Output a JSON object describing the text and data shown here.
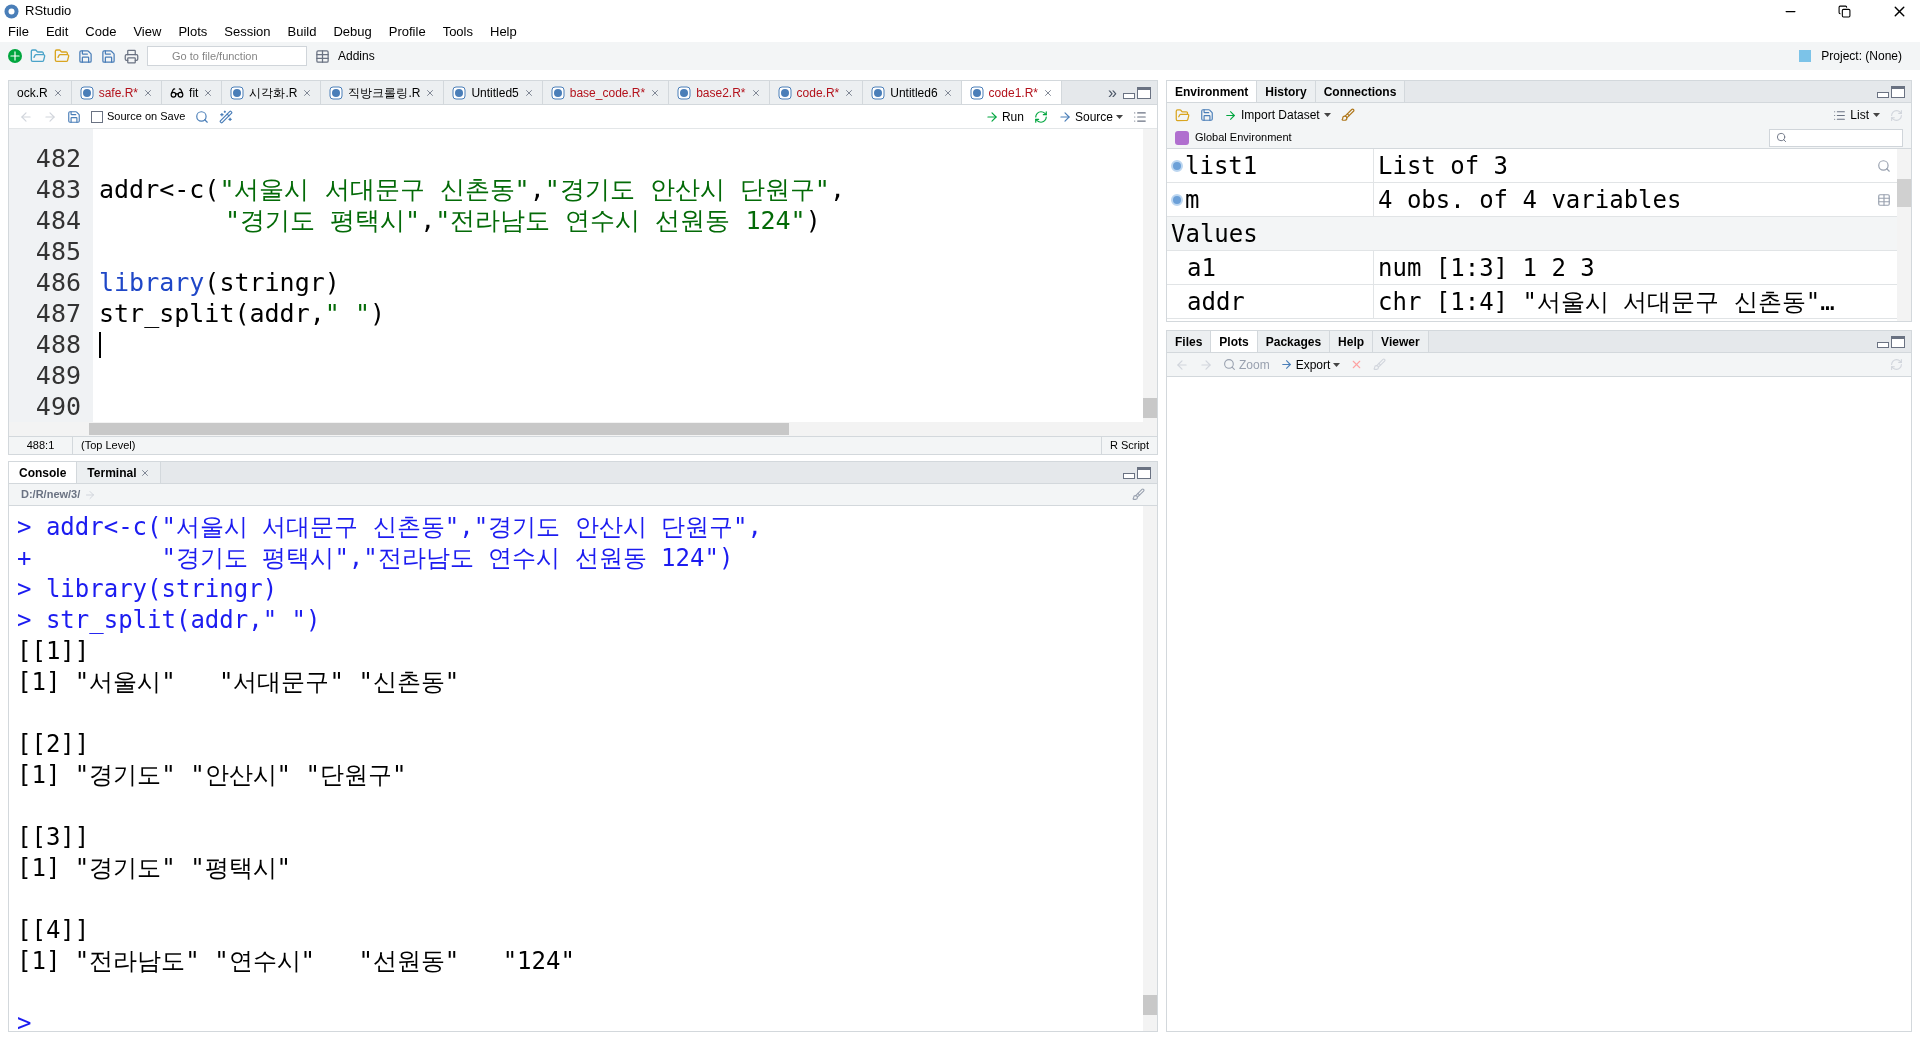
{
  "window": {
    "title": "RStudio"
  },
  "menu": [
    "File",
    "Edit",
    "Code",
    "View",
    "Plots",
    "Session",
    "Build",
    "Debug",
    "Profile",
    "Tools",
    "Help"
  ],
  "toolbar": {
    "search_placeholder": "Go to file/function",
    "addins": "Addins",
    "project": "Project: (None)"
  },
  "editor": {
    "tabs": [
      {
        "label": "ock.R",
        "kind": "clipped",
        "modified": false,
        "selected": false
      },
      {
        "label": "safe.R*",
        "kind": "script",
        "modified": true,
        "selected": false
      },
      {
        "label": "fit",
        "kind": "viewer",
        "modified": false,
        "selected": false
      },
      {
        "label": "시각화.R",
        "kind": "script",
        "modified": false,
        "selected": false
      },
      {
        "label": "직방크롤링.R",
        "kind": "script",
        "modified": false,
        "selected": false
      },
      {
        "label": "Untitled5",
        "kind": "script",
        "modified": false,
        "selected": false
      },
      {
        "label": "base_code.R*",
        "kind": "script",
        "modified": true,
        "selected": false
      },
      {
        "label": "base2.R*",
        "kind": "script",
        "modified": true,
        "selected": false
      },
      {
        "label": "code.R*",
        "kind": "script",
        "modified": true,
        "selected": false
      },
      {
        "label": "Untitled6",
        "kind": "script",
        "modified": false,
        "selected": false
      },
      {
        "label": "code1.R*",
        "kind": "script",
        "modified": true,
        "selected": true
      }
    ],
    "more_tabs": "»",
    "source_on_save": {
      "label": "Source on Save",
      "checked": false
    },
    "run": "Run",
    "source": "Source",
    "lines": [
      {
        "number": "482"
      },
      {
        "number": "483",
        "tokens": [
          {
            "kind": "plain",
            "text": "addr<-c("
          },
          {
            "kind": "string",
            "text": "\"서울시 서대문구 신촌동\""
          },
          {
            "kind": "plain",
            "text": ","
          },
          {
            "kind": "string",
            "text": "\"경기도 안산시 단원구\""
          },
          {
            "kind": "plain",
            "text": ","
          }
        ]
      },
      {
        "number": "484",
        "kind": "continuation",
        "tokens": [
          {
            "kind": "string",
            "text": "\"경기도 평택시\""
          },
          {
            "kind": "plain",
            "text": ","
          },
          {
            "kind": "string",
            "text": "\"전라남도 연수시 선원동 124\""
          },
          {
            "kind": "plain",
            "text": ")"
          }
        ]
      },
      {
        "number": "485"
      },
      {
        "number": "486",
        "tokens": [
          {
            "kind": "function",
            "text": "library"
          },
          {
            "kind": "plain",
            "text": "(stringr)"
          }
        ]
      },
      {
        "number": "487",
        "tokens": [
          {
            "kind": "plain",
            "text": "str_split(addr,"
          },
          {
            "kind": "string",
            "text": "\" \""
          },
          {
            "kind": "plain",
            "text": ")"
          }
        ]
      },
      {
        "number": "488",
        "cursor": true
      },
      {
        "number": "489"
      },
      {
        "number": "490"
      }
    ],
    "status": {
      "position": "488:1",
      "scope": "(Top Level)",
      "file_type": "R Script"
    }
  },
  "console": {
    "tabs": [
      {
        "label": "Console",
        "selected": true,
        "closable": false
      },
      {
        "label": "Terminal",
        "selected": false,
        "closable": true
      }
    ],
    "path": "D:/R/new/3/",
    "lines": [
      {
        "kind": "input",
        "prompt": ">",
        "text": "addr<-c(\"서울시 서대문구 신촌동\",\"경기도 안산시 단원구\","
      },
      {
        "kind": "input",
        "prompt": "+",
        "text": "        \"경기도 평택시\",\"전라남도 연수시 선원동 124\")"
      },
      {
        "kind": "input",
        "prompt": ">",
        "text": "library(stringr)"
      },
      {
        "kind": "input",
        "prompt": ">",
        "text": "str_split(addr,\" \")"
      },
      {
        "kind": "output",
        "text": "[[1]]"
      },
      {
        "kind": "output",
        "text": "[1] \"서울시\"   \"서대문구\" \"신촌동\""
      },
      {
        "kind": "blank"
      },
      {
        "kind": "output",
        "text": "[[2]]"
      },
      {
        "kind": "output",
        "text": "[1] \"경기도\" \"안산시\" \"단원구\""
      },
      {
        "kind": "blank"
      },
      {
        "kind": "output",
        "text": "[[3]]"
      },
      {
        "kind": "output",
        "text": "[1] \"경기도\" \"평택시\""
      },
      {
        "kind": "blank"
      },
      {
        "kind": "output",
        "text": "[[4]]"
      },
      {
        "kind": "output",
        "text": "[1] \"전라남도\" \"연수시\"   \"선원동\"   \"124\""
      },
      {
        "kind": "blank"
      },
      {
        "kind": "prompt",
        "prompt": ">"
      }
    ]
  },
  "environment": {
    "tabs": [
      {
        "label": "Environment",
        "selected": true
      },
      {
        "label": "History",
        "selected": false
      },
      {
        "label": "Connections",
        "selected": false
      }
    ],
    "import": "Import Dataset",
    "view": "List",
    "scope": "Global Environment",
    "rows": [
      {
        "kind": "list",
        "name": "list1",
        "value": "List of 3"
      },
      {
        "kind": "frame",
        "name": "m",
        "value": "4 obs. of 4 variables"
      },
      {
        "kind": "header",
        "name": "Values"
      },
      {
        "kind": "value",
        "name": "a1",
        "value": "num [1:3] 1 2 3"
      },
      {
        "kind": "value",
        "name": "addr",
        "value": "chr [1:4] \"서울시 서대문구 신촌동\"…"
      }
    ]
  },
  "files": {
    "tabs": [
      {
        "label": "Files",
        "selected": false
      },
      {
        "label": "Plots",
        "selected": true
      },
      {
        "label": "Packages",
        "selected": false
      },
      {
        "label": "Help",
        "selected": false
      },
      {
        "label": "Viewer",
        "selected": false
      }
    ],
    "zoom": "Zoom",
    "export": "Export"
  }
}
